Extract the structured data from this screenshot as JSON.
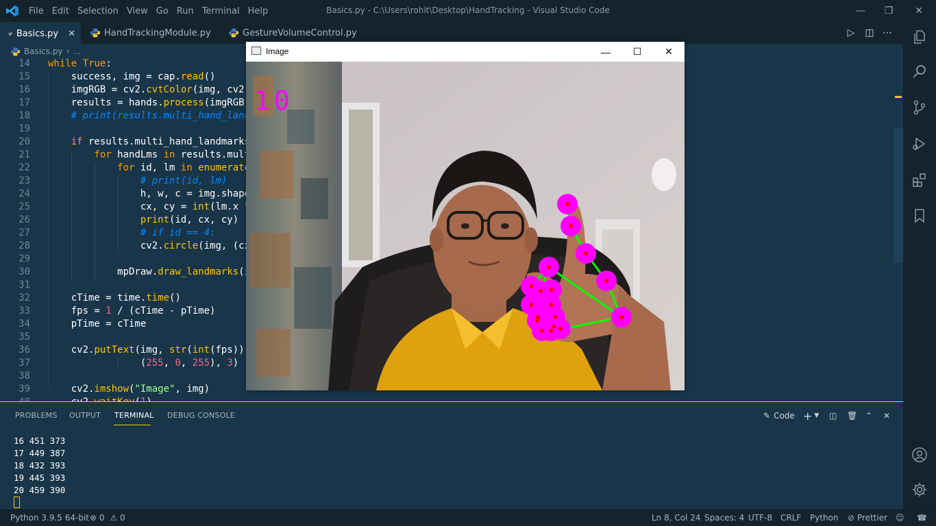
{
  "titlebar": {
    "menu": [
      "File",
      "Edit",
      "Selection",
      "View",
      "Go",
      "Run",
      "Terminal",
      "Help"
    ],
    "window_title": "Basics.py - C:\\Users\\rohit\\Desktop\\HandTracking - Visual Studio Code"
  },
  "tabs": [
    {
      "label": "Basics.py",
      "active": true
    },
    {
      "label": "HandTrackingModule.py",
      "active": false
    },
    {
      "label": "GestureVolumeControl.py",
      "active": false
    }
  ],
  "breadcrumb": {
    "file": "Basics.py",
    "rest": "..."
  },
  "editor": {
    "line_numbers": [
      "14",
      "15",
      "16",
      "17",
      "18",
      "19",
      "20",
      "21",
      "22",
      "23",
      "24",
      "25",
      "26",
      "27",
      "28",
      "29",
      "30",
      "31",
      "32",
      "33",
      "34",
      "35",
      "36",
      "37",
      "38",
      "39",
      "40"
    ]
  },
  "image_window": {
    "title": "Image",
    "fps_text": "10",
    "fps_color": "#ff00ff"
  },
  "panel": {
    "tabs": [
      "PROBLEMS",
      "OUTPUT",
      "TERMINAL",
      "DEBUG CONSOLE"
    ],
    "active_tab": "TERMINAL",
    "shell_label": "Code",
    "terminal_lines": [
      "16 451 373",
      "17 449 387",
      "18 432 393",
      "19 445 393",
      "20 459 390"
    ]
  },
  "statusbar": {
    "interpreter": "Python 3.9.5 64-bit",
    "errors": "0",
    "warnings": "0",
    "position": "Ln 8, Col 24",
    "spaces": "Spaces: 4",
    "encoding": "UTF-8",
    "eol": "CRLF",
    "language": "Python",
    "formatter": "Prettier"
  },
  "colors": {
    "accent": "#ffc600",
    "background": "#193549",
    "chrome": "#15232d",
    "keyword": "#ff9d00",
    "comment": "#0088ff",
    "landmark": "#ff00ff",
    "connection": "#00ff00"
  },
  "icons": [
    "vscode-logo-icon",
    "python-file-icon",
    "run-icon",
    "split-editor-icon",
    "more-icon",
    "explorer-icon",
    "search-icon",
    "source-control-icon",
    "run-debug-icon",
    "extensions-icon",
    "bookmark-icon",
    "account-icon",
    "settings-gear-icon",
    "error-icon",
    "warning-icon",
    "prettier-icon",
    "feedback-icon",
    "bell-icon"
  ]
}
